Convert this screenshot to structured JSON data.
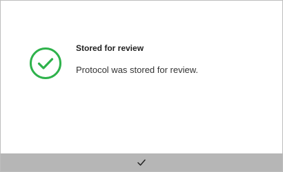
{
  "dialog": {
    "title": "Stored for review",
    "message": "Protocol was stored for review.",
    "status_icon": "check-circle-icon",
    "accent_color": "#2eb24b",
    "confirm_icon": "checkmark-icon",
    "footer_color": "#b6b6b6"
  }
}
